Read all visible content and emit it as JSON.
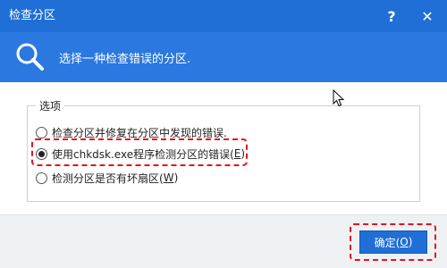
{
  "window": {
    "title": "检查分区",
    "help_label": "?",
    "close_label": "✕"
  },
  "header": {
    "description": "选择一种检查错误的分区."
  },
  "options": {
    "legend": "选项",
    "items": [
      {
        "text": "检查分区并修复在分区中发现的错误.",
        "hotkey": "",
        "suffix": "",
        "selected": false
      },
      {
        "text": "使用chkdsk.exe程序检测分区的错误(",
        "hotkey": "E",
        "suffix": ")",
        "selected": true
      },
      {
        "text": "检测分区是否有坏扇区(",
        "hotkey": "W",
        "suffix": ")",
        "selected": false
      }
    ]
  },
  "footer": {
    "ok_text": "确定(",
    "ok_hotkey": "O",
    "ok_suffix": ")"
  },
  "colors": {
    "titlebar": "#1f6fd6",
    "header": "#2a78e0",
    "highlight": "#e0141e",
    "button": "#1f6fd6"
  },
  "icons": [
    "search-icon",
    "help-icon",
    "close-icon",
    "mouse-cursor-icon"
  ]
}
